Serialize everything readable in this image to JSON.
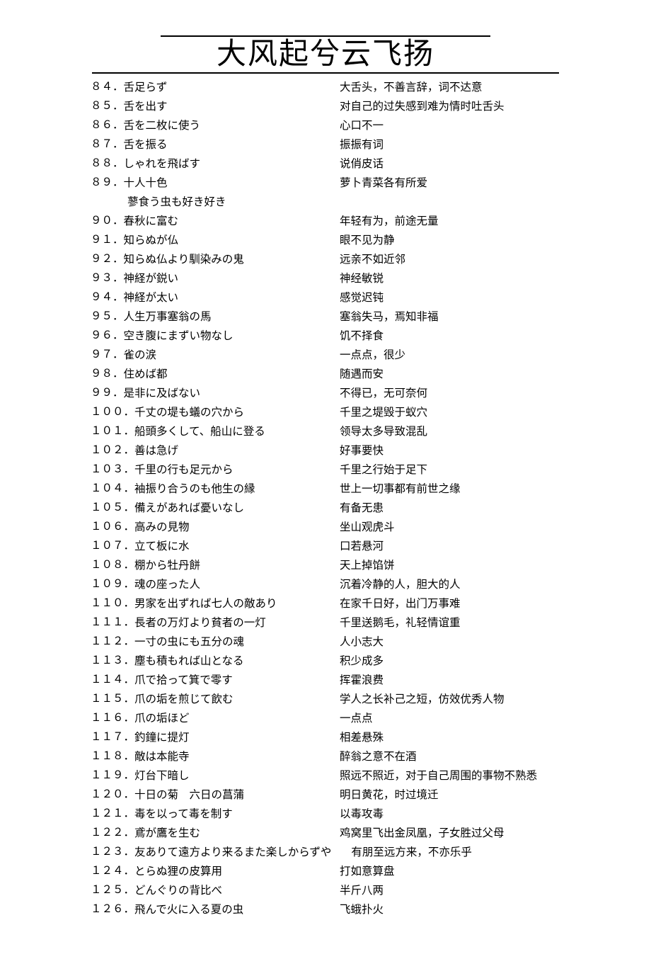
{
  "title": "大风起兮云飞扬",
  "entries": [
    {
      "num": "８４．",
      "jp": "舌足らず",
      "cn": "大舌头，不善言辞，词不达意"
    },
    {
      "num": "８５．",
      "jp": "舌を出す",
      "cn": "对自己的过失感到难为情时吐舌头"
    },
    {
      "num": "８６．",
      "jp": "舌を二枚に使う",
      "cn": "心口不一"
    },
    {
      "num": "８７．",
      "jp": "舌を振る",
      "cn": "振振有词"
    },
    {
      "num": "８８．",
      "jp": "しゃれを飛ばす",
      "cn": "说俏皮话"
    },
    {
      "num": "８９．",
      "jp": "十人十色",
      "cn": "萝卜青菜各有所爱",
      "sub": "蓼食う虫も好き好き"
    },
    {
      "num": "９０．",
      "jp": "春秋に富む",
      "cn": "年轻有为，前途无量"
    },
    {
      "num": "９１．",
      "jp": "知らぬが仏",
      "cn": "眼不见为静"
    },
    {
      "num": "９２．",
      "jp": "知らぬ仏より馴染みの鬼",
      "cn": "远亲不如近邻"
    },
    {
      "num": "９３．",
      "jp": "神経が鋭い",
      "cn": "神经敏锐"
    },
    {
      "num": "９４．",
      "jp": "神経が太い",
      "cn": "感觉迟钝"
    },
    {
      "num": "９５．",
      "jp": "人生万事塞翁の馬",
      "cn": "塞翁失马，焉知非福"
    },
    {
      "num": "９６．",
      "jp": "空き腹にまずい物なし",
      "cn": "饥不择食"
    },
    {
      "num": "９７．",
      "jp": "雀の涙",
      "cn": "一点点，很少"
    },
    {
      "num": "９８．",
      "jp": "住めば都",
      "cn": "随遇而安"
    },
    {
      "num": "９９．",
      "jp": "是非に及ばない",
      "cn": "不得已，无可奈何"
    },
    {
      "num": "１００．",
      "jp": "千丈の堤も蟻の穴から",
      "cn": "千里之堤毁于蚁穴"
    },
    {
      "num": "１０１．",
      "jp": "船頭多くして、船山に登る",
      "cn": "领导太多导致混乱"
    },
    {
      "num": "１０２．",
      "jp": "善は急げ",
      "cn": "好事要快"
    },
    {
      "num": "１０３．",
      "jp": "千里の行も足元から",
      "cn": "千里之行始于足下"
    },
    {
      "num": "１０４．",
      "jp": "袖振り合うのも他生の縁",
      "cn": "世上一切事都有前世之缘"
    },
    {
      "num": "１０５．",
      "jp": "備えがあれば憂いなし",
      "cn": "有备无患"
    },
    {
      "num": "１０６．",
      "jp": "高みの見物",
      "cn": "坐山观虎斗"
    },
    {
      "num": "１０７．",
      "jp": "立て板に水",
      "cn": "口若悬河"
    },
    {
      "num": "１０８．",
      "jp": "棚から牡丹餅",
      "cn": "天上掉馅饼"
    },
    {
      "num": "１０９．",
      "jp": "魂の座った人",
      "cn": "沉着冷静的人，胆大的人"
    },
    {
      "num": "１１０．",
      "jp": "男家を出ずれば七人の敵あり",
      "cn": "在家千日好，出门万事难"
    },
    {
      "num": "１１１．",
      "jp": "長者の万灯より貧者の一灯",
      "cn": "千里送鹅毛，礼轻情谊重"
    },
    {
      "num": "１１２．",
      "jp": "一寸の虫にも五分の魂",
      "cn": "人小志大"
    },
    {
      "num": "１１３．",
      "jp": "塵も積もれば山となる",
      "cn": "积少成多"
    },
    {
      "num": "１１４．",
      "jp": "爪で拾って箕で零す",
      "cn": "挥霍浪费"
    },
    {
      "num": "１１５．",
      "jp": "爪の垢を煎じて飲む",
      "cn": "学人之长补己之短，仿效优秀人物"
    },
    {
      "num": "１１６．",
      "jp": "爪の垢ほど",
      "cn": "一点点"
    },
    {
      "num": "１１７．",
      "jp": "釣鐘に提灯",
      "cn": "相差悬殊"
    },
    {
      "num": "１１８．",
      "jp": "敵は本能寺",
      "cn": "醉翁之意不在酒"
    },
    {
      "num": "１１９．",
      "jp": "灯台下暗し",
      "cn": "照远不照近，对于自己周围的事物不熟悉"
    },
    {
      "num": "１２０．",
      "jp": "十日の菊　六日の菖蒲",
      "cn": "明日黄花，时过境迁"
    },
    {
      "num": "１２１．",
      "jp": "毒を以って毒を制す",
      "cn": "以毒攻毒"
    },
    {
      "num": "１２２．",
      "jp": "鳶が鷹を生む",
      "cn": "鸡窝里飞出金凤凰，子女胜过父母"
    },
    {
      "num": "１２３．",
      "jp": "友ありて遠方より来るまた楽しからずや",
      "cn": "有朋至远方来，不亦乐乎",
      "long": true
    },
    {
      "num": "１２４．",
      "jp": "とらぬ狸の皮算用",
      "cn": "打如意算盘"
    },
    {
      "num": "１２５．",
      "jp": "どんぐりの背比べ",
      "cn": "半斤八两"
    },
    {
      "num": "１２６．",
      "jp": "飛んで火に入る夏の虫",
      "cn": "飞蛾扑火"
    }
  ]
}
